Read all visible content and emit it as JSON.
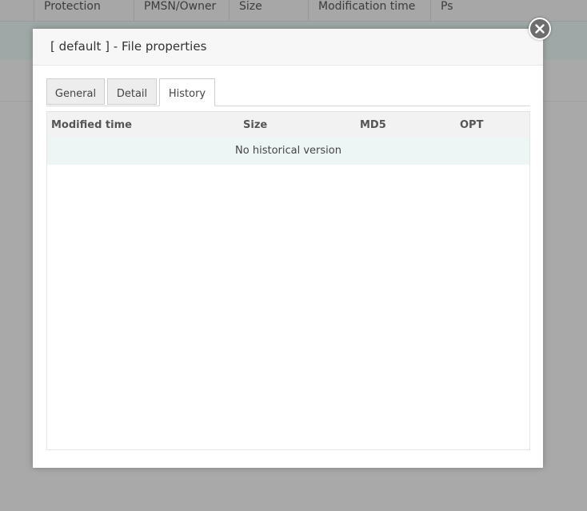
{
  "background_table": {
    "columns": [
      "Protection",
      "PMSN/Owner",
      "Size",
      "Modification time",
      "Ps"
    ]
  },
  "dialog": {
    "title": "[ default ] - File properties",
    "close_icon": "close-circle-icon",
    "tabs": [
      {
        "label": "General",
        "active": false
      },
      {
        "label": "Detail",
        "active": false
      },
      {
        "label": "History",
        "active": true
      }
    ],
    "history_table": {
      "columns": [
        "Modified time",
        "Size",
        "MD5",
        "OPT"
      ],
      "empty_message": "No historical version"
    }
  }
}
